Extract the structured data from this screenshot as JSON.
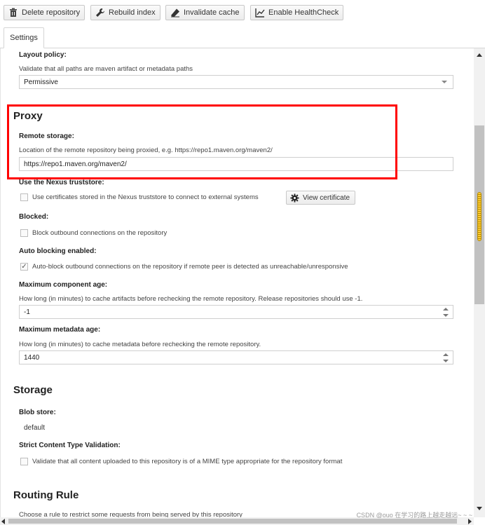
{
  "toolbar": {
    "delete_label": "Delete repository",
    "rebuild_label": "Rebuild index",
    "invalidate_label": "Invalidate cache",
    "healthcheck_label": "Enable HealthCheck"
  },
  "tabs": {
    "settings": "Settings"
  },
  "layout_policy": {
    "label": "Layout policy:",
    "help": "Validate that all paths are maven artifact or metadata paths",
    "value": "Permissive"
  },
  "proxy": {
    "title": "Proxy",
    "remote_storage_label": "Remote storage:",
    "remote_storage_help": "Location of the remote repository being proxied, e.g. https://repo1.maven.org/maven2/",
    "remote_storage_value": "https://repo1.maven.org/maven2/",
    "truststore_label": "Use the Nexus truststore:",
    "truststore_checkbox": "Use certificates stored in the Nexus truststore to connect to external systems",
    "truststore_checked": false,
    "view_certificate": "View certificate",
    "blocked_label": "Blocked:",
    "blocked_checkbox": "Block outbound connections on the repository",
    "blocked_checked": false,
    "auto_block_label": "Auto blocking enabled:",
    "auto_block_checkbox": "Auto-block outbound connections on the repository if remote peer is detected as unreachable/unresponsive",
    "auto_block_checked": true,
    "max_component_age_label": "Maximum component age:",
    "max_component_age_help": "How long (in minutes) to cache artifacts before rechecking the remote repository. Release repositories should use -1.",
    "max_component_age_value": "-1",
    "max_metadata_age_label": "Maximum metadata age:",
    "max_metadata_age_help": "How long (in minutes) to cache metadata before rechecking the remote repository.",
    "max_metadata_age_value": "1440"
  },
  "storage": {
    "title": "Storage",
    "blob_store_label": "Blob store:",
    "blob_store_value": "default",
    "strict_content_label": "Strict Content Type Validation:",
    "strict_content_checkbox": "Validate that all content uploaded to this repository is of a MIME type appropriate for the repository format",
    "strict_content_checked": false
  },
  "routing": {
    "title": "Routing Rule",
    "help": "Choose a rule to restrict some requests from being served by this repository"
  },
  "watermark": "CSDN @ouo 在学习的路上越走越远~ ~ ~",
  "colors": {
    "highlight": "#ff0000",
    "scroll_grip": "#ffcc33"
  },
  "icons": {
    "delete": "trash-icon",
    "rebuild": "wrench-icon",
    "invalidate": "eraser-icon",
    "healthcheck": "chart-line-icon",
    "view_certificate": "gear-icon"
  }
}
